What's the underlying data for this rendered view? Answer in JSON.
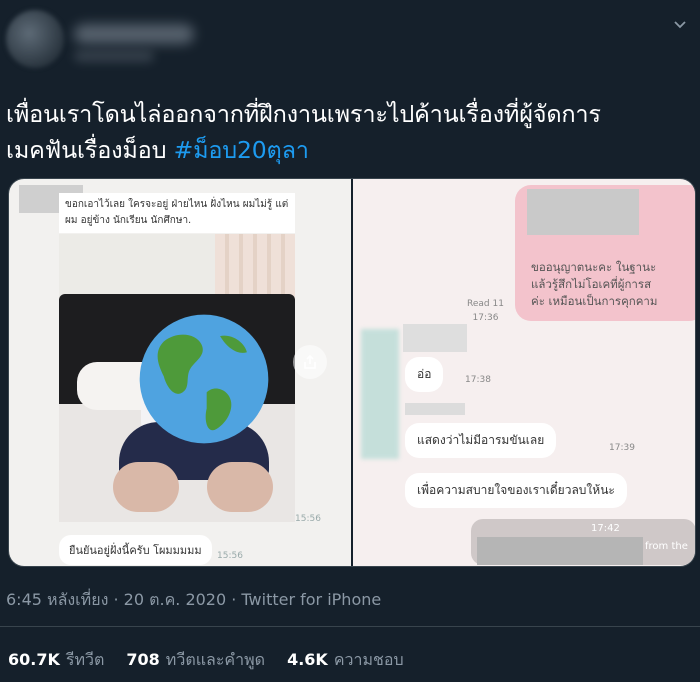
{
  "tweet": {
    "text_line1": "เพื่อนเราโดนไล่ออกจากที่ฝึกงานเพราะไปค้านเรื่องที่ผู้จัดการ",
    "text_line2": "เมคฟันเรื่องม็อบ ",
    "hashtag": "#ม็อบ20ตุลา",
    "more_icon": "more-icon"
  },
  "media": {
    "left": {
      "caption": "ขอกเอาไว้เลย ใครจะอยู่ ฝ่ายไหน ฝั่งไหน ผมไม่รู้ แต่ ผม อยู่ข้าง นักเรียน นักศึกษา.",
      "time1": "15:56",
      "bubble": "ยืนยันอยู่ฝั่งนี้ครับ โผมมมมม",
      "time2": "15:56",
      "share_icon": "share-icon",
      "globe_icon": "globe-icon"
    },
    "right": {
      "pink_text_1": "ขออนุญาตนะคะ ในฐานะ",
      "pink_text_2": "แล้วรู้สึกไม่โอเคที่ผู้การส",
      "pink_text_3": "ค่ะ เหมือนเป็นการคุกคาม",
      "read_label": "Read 11",
      "read_time": "17:36",
      "msg1": "อ่อ",
      "msg1_time": "17:38",
      "msg2": "แสดงว่าไม่มีอารมขันเลย",
      "msg2_time": "17:39",
      "msg3": "เพื่อความสบายใจของเราเดี๋ยวลบให้นะ",
      "bottom_time": "17:42",
      "bottom_text": "from the"
    }
  },
  "meta": {
    "timestamp": "6:45 หลังเที่ยง · 20 ต.ค. 2020 · Twitter for iPhone"
  },
  "stats": {
    "retweets_count": "60.7K",
    "retweets_label": "รีทวีต",
    "quotes_count": "708",
    "quotes_label": "ทวีตและคำพูด",
    "likes_count": "4.6K",
    "likes_label": "ความชอบ"
  },
  "colors": {
    "background": "#15202b",
    "accent": "#1d9bf0",
    "muted": "#8b98a5"
  }
}
